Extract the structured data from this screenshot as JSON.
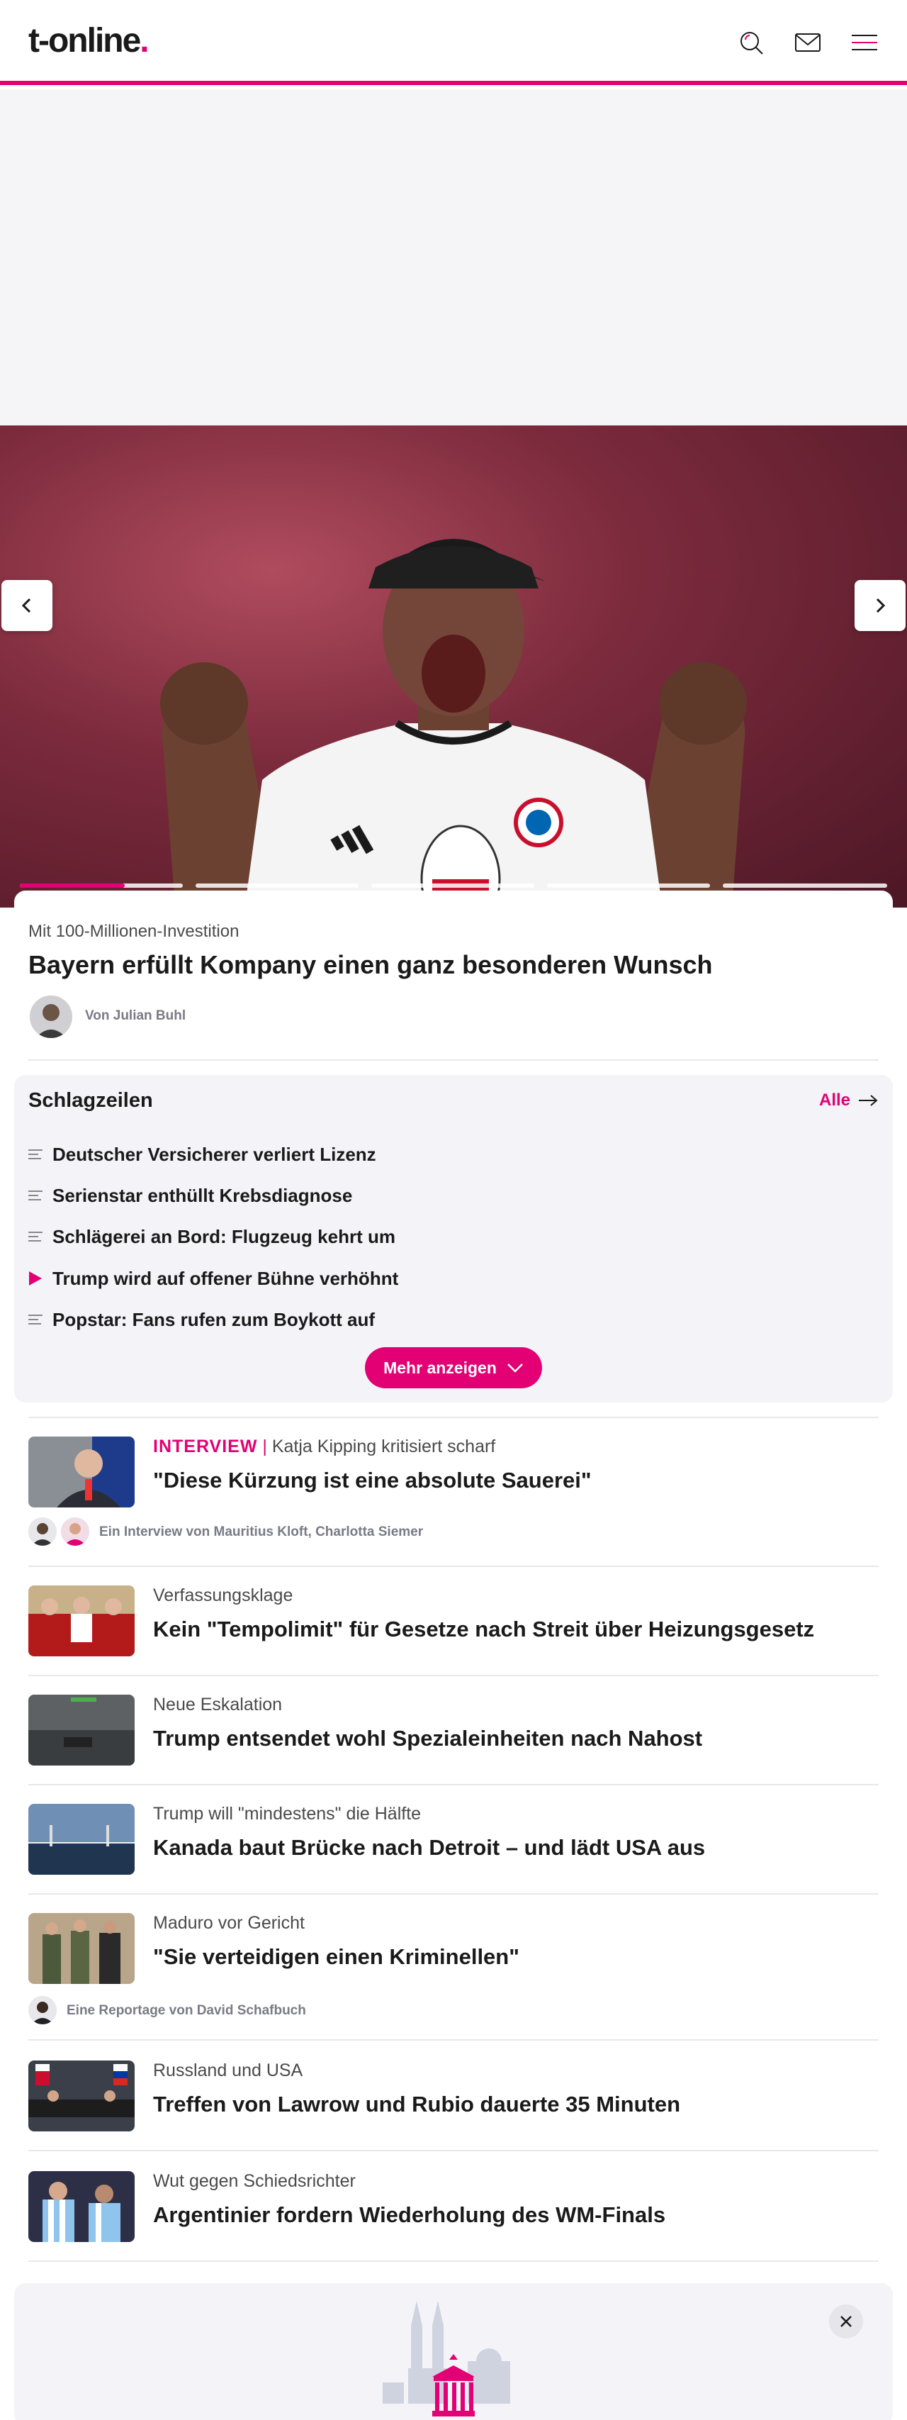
{
  "header": {
    "logo_text": "t-online",
    "logo_dot": ".",
    "icons": [
      "search-icon",
      "mail-icon",
      "menu-icon"
    ],
    "accent_color": "#e20074"
  },
  "hero": {
    "kicker": "Mit 100-Millionen-Investition",
    "title": "Bayern erfüllt Kompany einen ganz besonderen Wunsch",
    "author": "Von Julian Buhl",
    "slides_total": 6,
    "active_slide": 1,
    "active_slide_progress": 0.6
  },
  "headlines": {
    "title": "Schlagzeilen",
    "all_label": "Alle",
    "items": [
      {
        "label": "Deutscher Versicherer verliert Lizenz",
        "icon": "article-icon"
      },
      {
        "label": "Serienstar enthüllt Krebsdiagnose",
        "icon": "article-icon"
      },
      {
        "label": "Schlägerei an Bord: Flugzeug kehrt um",
        "icon": "article-icon"
      },
      {
        "label": "Trump wird auf offener Bühne verhöhnt",
        "icon": "video-play-icon"
      },
      {
        "label": "Popstar: Fans rufen zum Boykott auf",
        "icon": "article-icon"
      }
    ],
    "more_label": "Mehr anzeigen"
  },
  "teasers": [
    {
      "label_tag": "INTERVIEW",
      "divider": " | ",
      "kicker": "Katja Kipping kritisiert scharf",
      "title": "\"Diese Kürzung ist eine absolute Sauerei\"",
      "author": "Ein Interview von Mauritius Kloft, Charlotta Siemer"
    },
    {
      "kicker": "Verfassungsklage",
      "title": "Kein \"Tempolimit\" für Gesetze nach Streit über Heizungsgesetz"
    },
    {
      "kicker": "Neue Eskalation",
      "title": "Trump entsendet wohl Spezialeinheiten nach Nahost"
    },
    {
      "kicker": "Trump will \"mindestens\" die Hälfte",
      "title": "Kanada baut Brücke nach Detroit – und lädt USA aus"
    },
    {
      "kicker": "Maduro vor Gericht",
      "title": "\"Sie verteidigen einen Kriminellen\"",
      "author": "Eine Reportage von David Schafbuch"
    },
    {
      "kicker": "Russland und USA",
      "title": "Treffen von Lawrow und Rubio dauerte 35 Minuten"
    },
    {
      "kicker": "Wut gegen Schiedsrichter",
      "title": "Argentinier fordern Wiederholung des WM-Finals"
    }
  ]
}
